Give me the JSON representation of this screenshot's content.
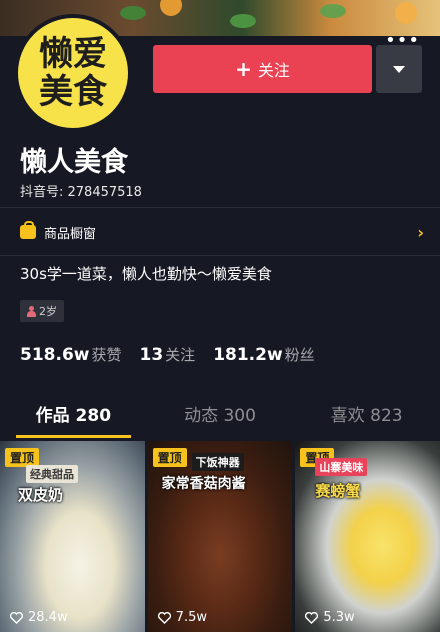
{
  "header": {
    "avatar_text": "懒爱美食",
    "follow_label": "关注",
    "follow_plus": "+",
    "more_icon": "more-dots-icon",
    "dropdown_icon": "triangle-down-icon"
  },
  "profile": {
    "nickname": "懒人美食",
    "douyin_id": "抖音号: 278457518",
    "shop_label": "商品橱窗",
    "bio": "30s学一道菜，懒人也勤快～懒爱美食",
    "age_tag": "2岁"
  },
  "stats": [
    {
      "num": "518.6w",
      "label": "获赞"
    },
    {
      "num": "13",
      "label": "关注"
    },
    {
      "num": "181.2w",
      "label": "粉丝"
    }
  ],
  "tabs": [
    {
      "label": "作品 280",
      "active": true
    },
    {
      "label": "动态 300",
      "active": false
    },
    {
      "label": "喜欢 823",
      "active": false
    }
  ],
  "videos": [
    {
      "pin": "置顶",
      "tag": "经典甜品",
      "title": "双皮奶",
      "likes": "28.4w"
    },
    {
      "pin": "置顶",
      "tag": "下饭神器",
      "title": "家常香菇肉酱",
      "likes": "7.5w"
    },
    {
      "pin": "置顶",
      "tag": "山寨美味",
      "title": "赛螃蟹",
      "likes": "5.3w"
    }
  ],
  "colors": {
    "background": "#161823",
    "follow_button": "#ea4153",
    "accent_yellow": "#f6c21b"
  }
}
